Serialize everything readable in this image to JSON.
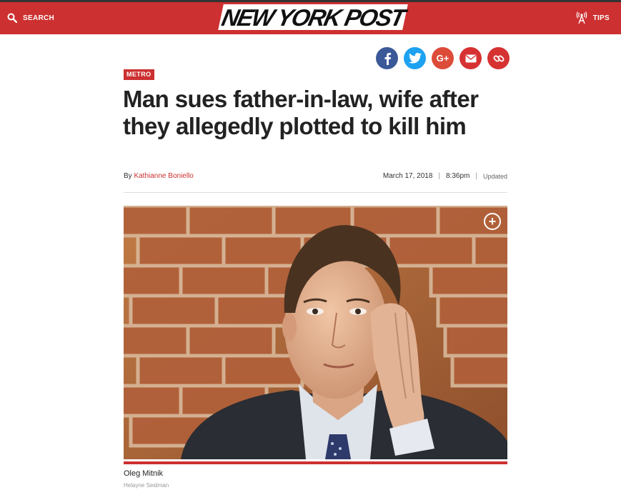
{
  "header": {
    "search_label": "SEARCH",
    "logo_text": "NEW YORK POST",
    "tips_label": "TIPS",
    "brand_color": "#cd3030"
  },
  "share": {
    "icons": [
      "facebook-icon",
      "twitter-icon",
      "google-plus-icon",
      "email-icon",
      "link-icon"
    ],
    "gplus_label": "G+"
  },
  "article": {
    "section": "METRO",
    "headline": "Man sues father-in-law, wife after they allegedly plotted to kill him",
    "byline_prefix": "By",
    "author": "Kathianne Boniello",
    "date": "March 17, 2018",
    "time": "8:36pm",
    "updated": "Updated",
    "separator": "|"
  },
  "photo": {
    "caption": "Oleg Mitnik",
    "credit": "Helayne Seidman",
    "expand_symbol": "+"
  }
}
